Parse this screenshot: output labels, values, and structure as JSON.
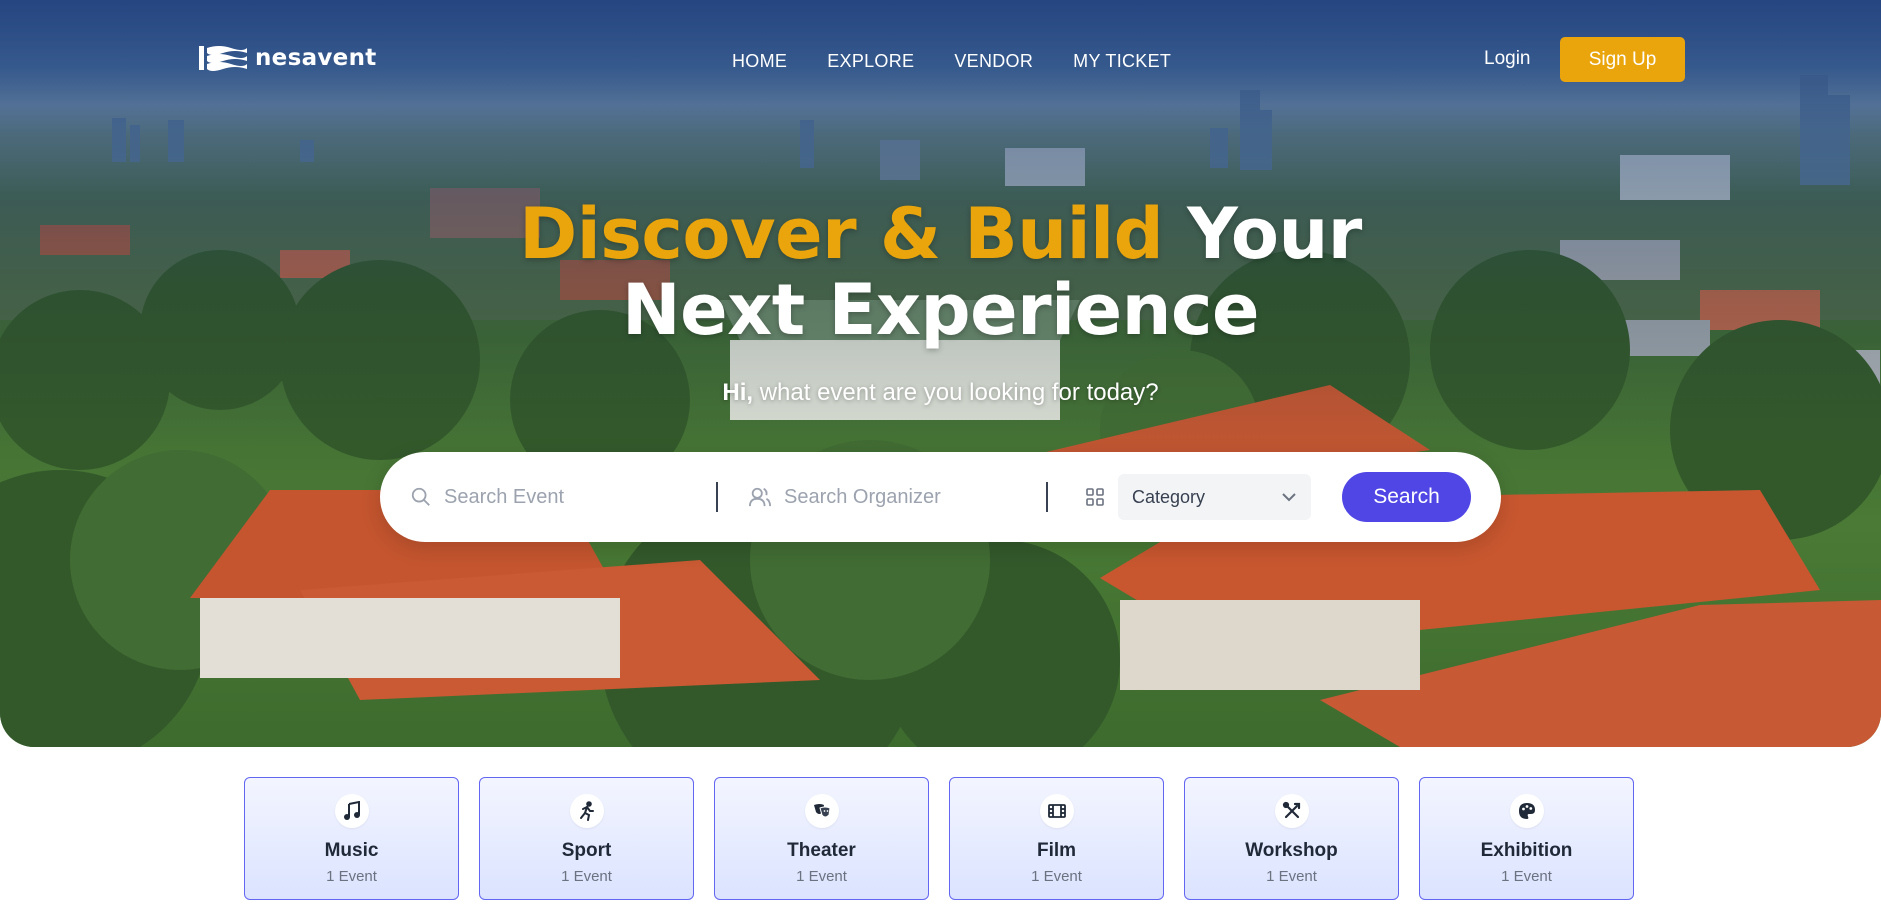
{
  "brand": {
    "name": "nesavent",
    "accent_color": "#eaa50c",
    "primary_color": "#4f46e5"
  },
  "nav": {
    "items": [
      "HOME",
      "EXPLORE",
      "VENDOR",
      "MY TICKET"
    ]
  },
  "auth": {
    "login_label": "Login",
    "signup_label": "Sign Up"
  },
  "hero": {
    "headline_accent": "Discover & Build",
    "headline_rest_1": "Your",
    "headline_line_2": "Next Experience",
    "greeting": "Hi,",
    "subtitle": "what event are you looking for today?"
  },
  "search": {
    "event_placeholder": "Search Event",
    "organizer_placeholder": "Search Organizer",
    "category_value": "Category",
    "button_label": "Search",
    "icons": [
      "search-icon",
      "user-icon",
      "grid-icon",
      "chevron-down-icon"
    ]
  },
  "categories": [
    {
      "name": "Music",
      "count": "1 Event",
      "icon": "music-note-icon"
    },
    {
      "name": "Sport",
      "count": "1 Event",
      "icon": "running-icon"
    },
    {
      "name": "Theater",
      "count": "1 Event",
      "icon": "theater-masks-icon"
    },
    {
      "name": "Film",
      "count": "1 Event",
      "icon": "film-icon"
    },
    {
      "name": "Workshop",
      "count": "1 Event",
      "icon": "tools-icon"
    },
    {
      "name": "Exhibition",
      "count": "1 Event",
      "icon": "palette-icon"
    }
  ]
}
